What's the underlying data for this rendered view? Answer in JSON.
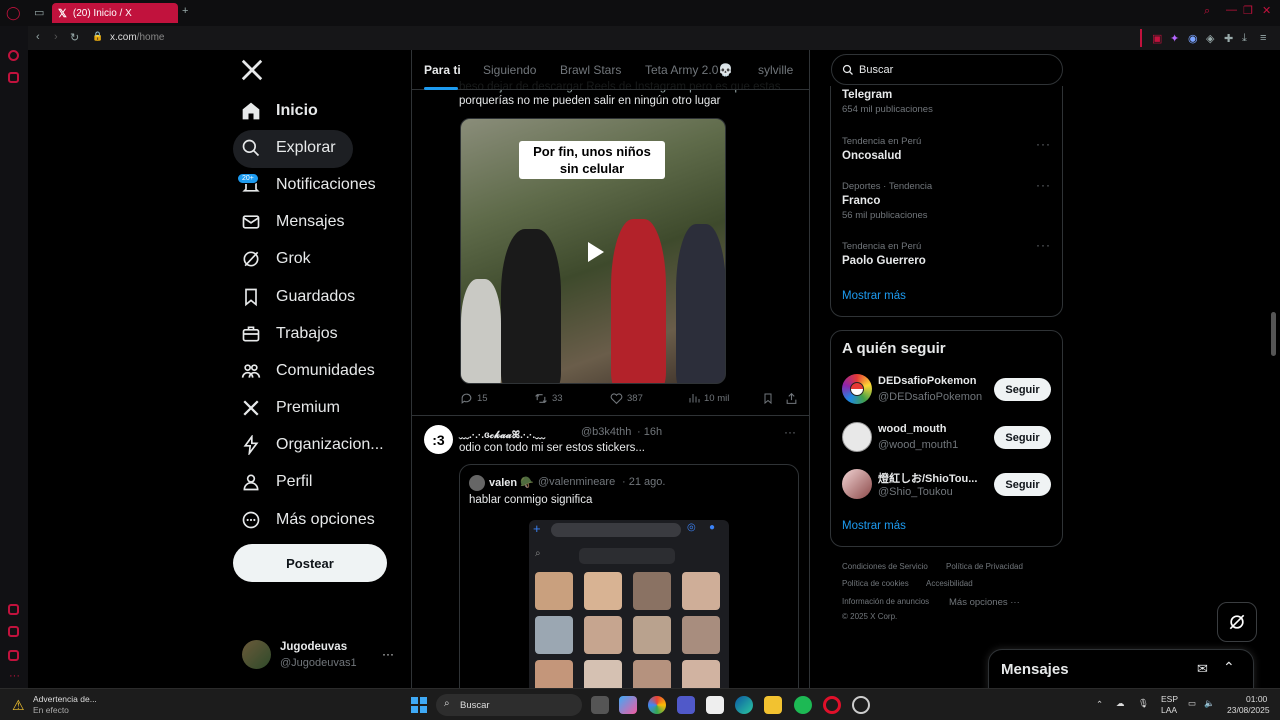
{
  "browser": {
    "tab_title": "(20) Inicio / X",
    "tab_icon": "x-logo-icon",
    "url_host": "x.com",
    "url_path": "/home",
    "tab_color": "#c1123d"
  },
  "nav": {
    "logo_icon": "x-logo-icon",
    "items": [
      {
        "label": "Inicio",
        "icon": "home-icon"
      },
      {
        "label": "Explorar",
        "icon": "search-icon"
      },
      {
        "label": "Notificaciones",
        "icon": "bell-icon",
        "badge": "20+"
      },
      {
        "label": "Mensajes",
        "icon": "mail-icon"
      },
      {
        "label": "Grok",
        "icon": "grok-icon"
      },
      {
        "label": "Guardados",
        "icon": "bookmark-icon"
      },
      {
        "label": "Trabajos",
        "icon": "briefcase-icon"
      },
      {
        "label": "Comunidades",
        "icon": "people-icon"
      },
      {
        "label": "Premium",
        "icon": "x-logo-icon"
      },
      {
        "label": "Organizacion...",
        "icon": "lightning-icon"
      },
      {
        "label": "Perfil",
        "icon": "person-icon"
      },
      {
        "label": "Más opciones",
        "icon": "more-circle-icon"
      }
    ],
    "post_button": "Postear",
    "account": {
      "name": "Jugodeuvas",
      "handle": "@Jugodeuvas1",
      "more": "···"
    }
  },
  "timeline": {
    "tabs": [
      "Para ti",
      "Siguiendo",
      "Brawl Stars",
      "Teta Army 2.0💀",
      "sylville"
    ],
    "active_tab": 0,
    "tweet1": {
      "text_partial": "beso dejar de descargar Reels de Instagram pero es que estas",
      "text": "porquerías no me pueden salir en ningún otro lugar",
      "video_caption": "Por fin, unos niños sin celular",
      "replies": "15",
      "retweets": "33",
      "likes": "387",
      "views": "10 mil"
    },
    "tweet2": {
      "avatar_text": ":3",
      "name": "﹏.·.·.ɞ𝓬𝓴𝓪𝓪ꕤ.·.·.﹏",
      "handle": "@b3k4thh",
      "time": "· 16h",
      "more": "···",
      "text": "odio con todo mi ser estos stickers...",
      "quote": {
        "name": "valen 🪖",
        "handle": "@valenmineare",
        "time": "· 21 ago.",
        "text": "hablar conmigo significa"
      }
    }
  },
  "right": {
    "search_placeholder": "Buscar",
    "trends": [
      {
        "meta": "",
        "name": "Telegram",
        "posts": "654 mil publicaciones"
      },
      {
        "meta": "Tendencia en Perú",
        "name": "Oncosalud",
        "posts": ""
      },
      {
        "meta": "Deportes · Tendencia",
        "name": "Franco",
        "posts": "56 mil publicaciones"
      },
      {
        "meta": "Tendencia en Perú",
        "name": "Paolo Guerrero",
        "posts": ""
      }
    ],
    "trends_more": "Mostrar más",
    "who_to_follow": {
      "title": "A quién seguir",
      "users": [
        {
          "name": "DEDsafioPokemon",
          "handle": "@DEDsafioPokemon",
          "button": "Seguir"
        },
        {
          "name": "wood_mouth",
          "handle": "@wood_mouth1",
          "button": "Seguir"
        },
        {
          "name": "燈紅しお/ShioTou...",
          "handle": "@Shio_Toukou",
          "button": "Seguir"
        }
      ],
      "more": "Mostrar más"
    },
    "footer": {
      "links": [
        "Condiciones de Servicio",
        "Política de Privacidad",
        "Política de cookies",
        "Accesibilidad",
        "Información de anuncios",
        "Más opciones ···"
      ],
      "copyright": "© 2025 X Corp."
    },
    "messages_title": "Mensajes"
  },
  "taskbar": {
    "weather_title": "Advertencia de...",
    "weather_sub": "En efecto",
    "search": "Buscar",
    "lang": "ESP",
    "lang2": "LAA",
    "time": "01:00",
    "date": "23/08/2025"
  }
}
